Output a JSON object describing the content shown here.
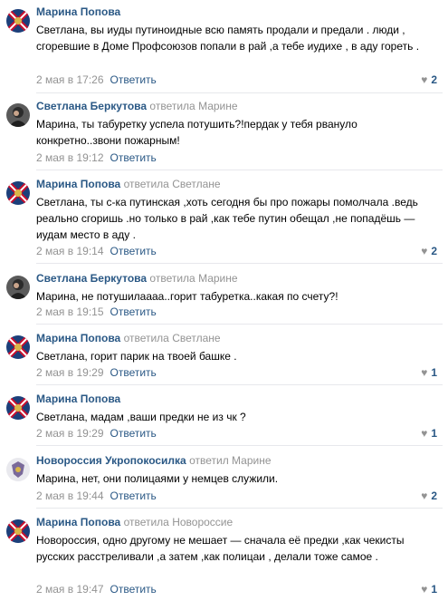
{
  "colors": {
    "link": "#2a5885",
    "muted": "#939393",
    "divider": "#e7e8ec"
  },
  "reply_label": "Ответить",
  "comments": [
    {
      "author": "Марина Попова",
      "reply_prefix": "",
      "reply_to": "",
      "text": "Светлана, вы иуды путиноидные всю память продали и предали . люди , сгоревшие в Доме Профсоюзов попали в рай ,а тебе иудихе , в аду гореть .",
      "date": "2 мая в 17:26",
      "likes": "2",
      "avatar_icon": "flag-avatar-icon"
    },
    {
      "author": "Светлана Беркутова",
      "reply_prefix": "ответила",
      "reply_to": "Марине",
      "text": "Марина, ты табуретку успела потушить?!пердак у тебя рвануло конкретно..звони пожарным!",
      "date": "2 мая в 19:12",
      "likes": "",
      "avatar_icon": "person-photo-avatar-icon"
    },
    {
      "author": "Марина Попова",
      "reply_prefix": "ответила",
      "reply_to": "Светлане",
      "text": "Светлана, ты с-ка путинская ,хоть сегодня бы про пожары помолчала .ведь реально сгоришь .но только в рай ,как тебе путин обещал ,не попадёшь — иудам место в аду .",
      "date": "2 мая в 19:14",
      "likes": "2",
      "avatar_icon": "flag-avatar-icon"
    },
    {
      "author": "Светлана Беркутова",
      "reply_prefix": "ответила",
      "reply_to": "Марине",
      "text": "Марина, не потушилаааа..горит табуретка..какая по счету?!",
      "date": "2 мая в 19:15",
      "likes": "",
      "avatar_icon": "person-photo-avatar-icon"
    },
    {
      "author": "Марина Попова",
      "reply_prefix": "ответила",
      "reply_to": "Светлане",
      "text": "Светлана, горит парик на твоей башке .",
      "date": "2 мая в 19:29",
      "likes": "1",
      "avatar_icon": "flag-avatar-icon"
    },
    {
      "author": "Марина Попова",
      "reply_prefix": "",
      "reply_to": "",
      "text": "Светлана, мадам ,ваши предки не из чк ?",
      "date": "2 мая в 19:29",
      "likes": "1",
      "avatar_icon": "flag-avatar-icon"
    },
    {
      "author": "Новороссия Укропокосилка",
      "reply_prefix": "ответил",
      "reply_to": "Марине",
      "text": "Марина, нет, они полицаями у немцев служили.",
      "date": "2 мая в 19:44",
      "likes": "2",
      "avatar_icon": "emblem-avatar-icon"
    },
    {
      "author": "Марина Попова",
      "reply_prefix": "ответила",
      "reply_to": "Новороссие",
      "text": "Новороссия, одно другому не мешает — сначала её предки ,как чекисты русских расстреливали ,а затем ,как полицаи , делали тоже самое .",
      "date": "2 мая в 19:47",
      "likes": "1",
      "avatar_icon": "flag-avatar-icon"
    }
  ]
}
